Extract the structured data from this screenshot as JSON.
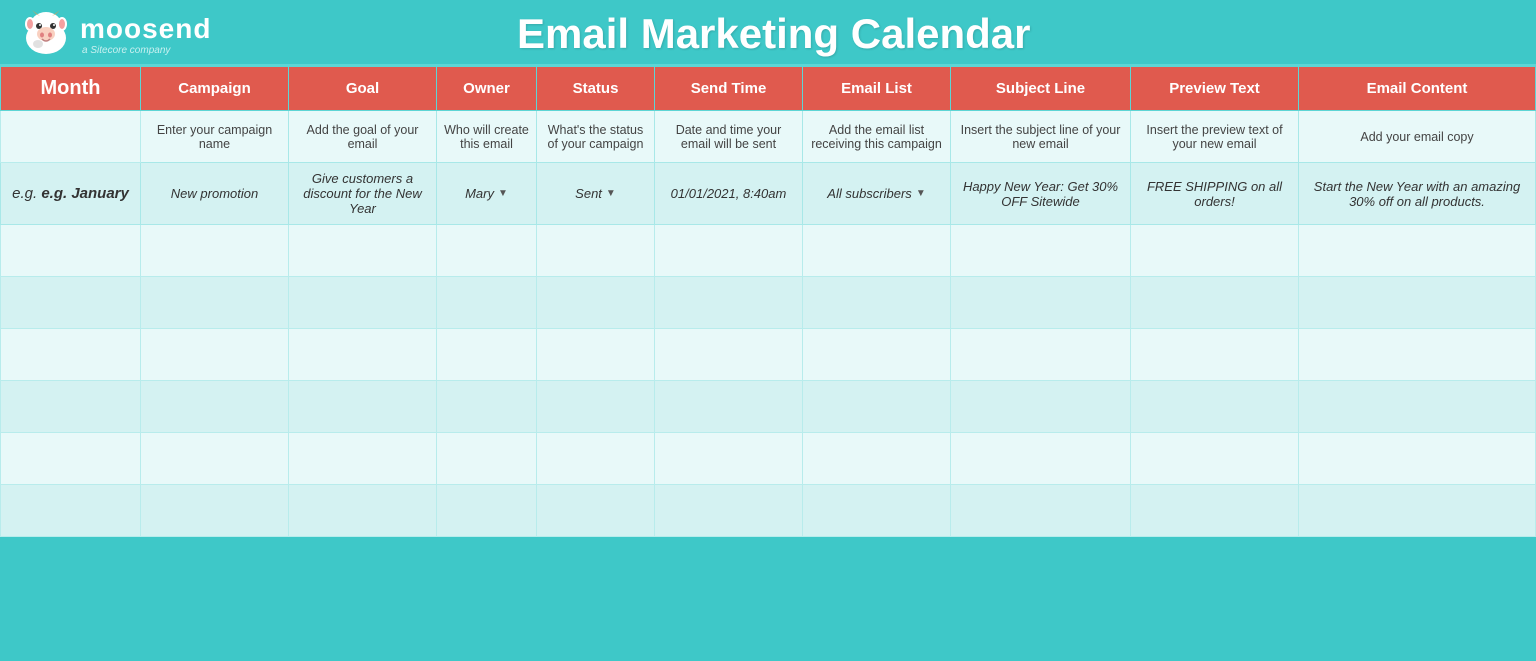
{
  "header": {
    "logo_name": "moosend",
    "logo_tagline": "a Sitecore company",
    "title": "Email Marketing Calendar"
  },
  "columns": {
    "month": "Month",
    "campaign": "Campaign",
    "goal": "Goal",
    "owner": "Owner",
    "status": "Status",
    "send_time": "Send Time",
    "email_list": "Email List",
    "subject_line": "Subject Line",
    "preview_text": "Preview Text",
    "email_content": "Email Content"
  },
  "descriptions": {
    "campaign": "Enter your campaign name",
    "goal": "Add the goal of your email",
    "owner": "Who will create this email",
    "status": "What's the status of your campaign",
    "send_time": "Date and time your email will be sent",
    "email_list": "Add the email list receiving this campaign",
    "subject_line": "Insert the subject line of your new email",
    "preview_text": "Insert the preview text of your new email",
    "email_content": "Add your email copy"
  },
  "example_row": {
    "month": "e.g. January",
    "campaign": "New promotion",
    "goal": "Give customers a discount for the New Year",
    "owner": "Mary",
    "status": "Sent",
    "send_time": "01/01/2021, 8:40am",
    "email_list": "All subscribers",
    "subject_line": "Happy New Year: Get 30% OFF Sitewide",
    "preview_text": "FREE SHIPPING on all orders!",
    "email_content": "Start the New Year with an amazing 30% off on all products."
  },
  "empty_rows": 6
}
